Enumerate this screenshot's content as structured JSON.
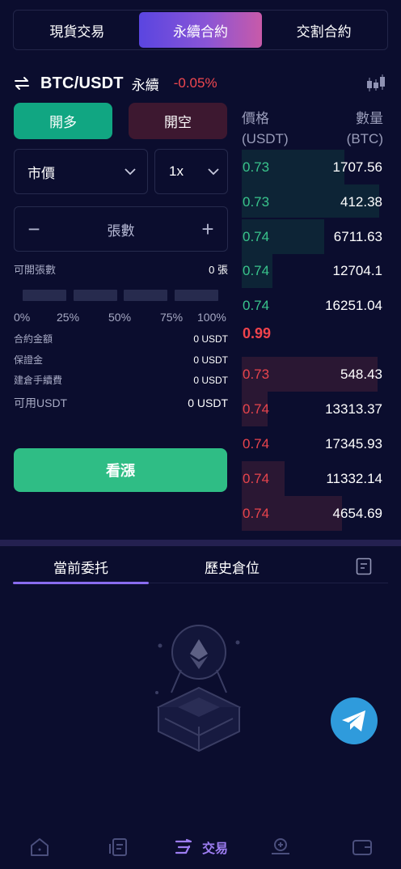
{
  "tabs": [
    "現貨交易",
    "永續合約",
    "交割合約"
  ],
  "active_tab_index": 1,
  "pair": {
    "symbol": "BTC/USDT",
    "kind": "永續",
    "change": "-0.05%"
  },
  "order": {
    "long_label": "開多",
    "short_label": "開空",
    "type_value": "市價",
    "leverage_value": "1x",
    "qty_label": "張數",
    "openable_label": "可開張數",
    "openable_value": "0 張",
    "slider_level": 0,
    "percents": [
      "0%",
      "25%",
      "50%",
      "75%",
      "100%"
    ],
    "contract_amount_label": "合約金額",
    "contract_amount_value": "0 USDT",
    "margin_label": "保證金",
    "margin_value": "0 USDT",
    "fee_label": "建倉手續費",
    "fee_value": "0 USDT",
    "available_label": "可用USDT",
    "available_value": "0 USDT",
    "submit_label": "看漲"
  },
  "orderbook": {
    "price_header": "價格",
    "price_unit": "(USDT)",
    "qty_header": "數量",
    "qty_unit": "(BTC)",
    "bids": [
      {
        "price": "0.73",
        "amount": "1707.56"
      },
      {
        "price": "0.73",
        "amount": "412.38"
      },
      {
        "price": "0.74",
        "amount": "6711.63"
      },
      {
        "price": "0.74",
        "amount": "12704.1"
      },
      {
        "price": "0.74",
        "amount": "16251.04"
      }
    ],
    "mid_price": "0.99",
    "asks": [
      {
        "price": "0.73",
        "amount": "548.43"
      },
      {
        "price": "0.74",
        "amount": "13313.37"
      },
      {
        "price": "0.74",
        "amount": "17345.93"
      },
      {
        "price": "0.74",
        "amount": "11332.14"
      },
      {
        "price": "0.74",
        "amount": "4654.69"
      }
    ]
  },
  "bottom_tabs": [
    "當前委托",
    "歷史倉位"
  ],
  "nav": {
    "active_label": "交易"
  },
  "colors": {
    "accent": "#8a6cf0",
    "up": "#39c48c",
    "down": "#e8444d",
    "buy_button": "#2fbd85",
    "telegram": "#2f9bdc"
  }
}
